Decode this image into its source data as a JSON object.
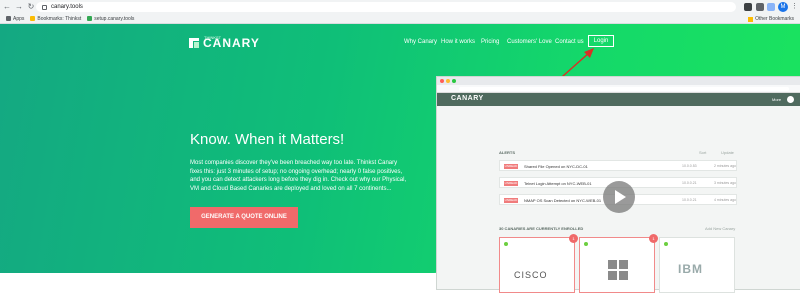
{
  "browser": {
    "url": "canary.tools",
    "bookmarks": [
      "Apps",
      "Bookmarks: Thinkst",
      "setup.canary.tools"
    ],
    "other_bookmarks": "Other Bookmarks",
    "avatar_letter": "M"
  },
  "site": {
    "logo_small": "THINKST",
    "logo_word": "CANARY",
    "nav": [
      "Why Canary",
      "How it works",
      "Pricing",
      "Customers' Love",
      "Contact us"
    ],
    "login": "Login",
    "headline": "Know. When it Matters!",
    "body": "Most companies discover they've been breached way too late. Thinkst Canary fixes this: just 3 minutes of setup; no ongoing overhead; nearly 0 false positives, and you can detect attackers long before they dig in. Check out why our Physical, VM and Cloud Based Canaries are deployed and loved on all 7 continents...",
    "cta": "GENERATE A QUOTE ONLINE"
  },
  "console": {
    "logo_word": "CANARY",
    "more": "More",
    "alerts_title": "ALERTS",
    "alerts_links": [
      "Sort",
      "Update"
    ],
    "alerts": [
      {
        "badge": "UNREAD",
        "msg": "Shared File Opened on NYC-DC-01",
        "ip": "10.0.0.53",
        "ago": "2 minutes ago"
      },
      {
        "badge": "UNREAD",
        "msg": "Telnet Login Attempt on NYC-WEB-01",
        "ip": "10.0.0.21",
        "ago": "3 minutes ago"
      },
      {
        "badge": "UNREAD",
        "msg": "NMAP OS Scan Detected on NYC-WEB-01",
        "ip": "10.0.0.21",
        "ago": "4 minutes ago"
      }
    ],
    "canaries_title": "30 CANARIES ARE CURRENTLY ENROLLED",
    "canaries_link": "Add New Canary",
    "cards": [
      {
        "label": "CISCO",
        "badge": "1"
      },
      {
        "label": "",
        "badge": "1"
      },
      {
        "label": "IBM",
        "badge": ""
      }
    ]
  },
  "colors": {
    "accent": "#0fbf78",
    "cta": "#f06a6a",
    "alert": "#f07b7b"
  }
}
